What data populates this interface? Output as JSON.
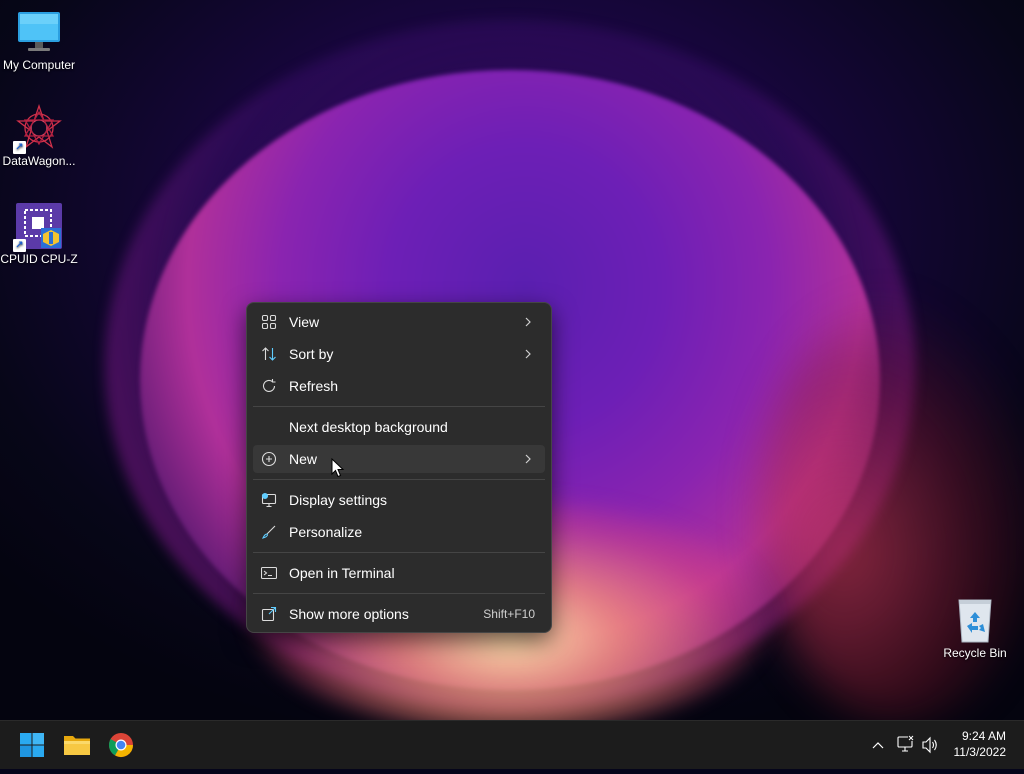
{
  "desktop": {
    "icons": [
      {
        "label": "My Computer"
      },
      {
        "label": "DataWagon..."
      },
      {
        "label": "CPUID CPU-Z"
      },
      {
        "label": "Recycle Bin"
      }
    ]
  },
  "context_menu": {
    "items": [
      {
        "label": "View",
        "icon": "grid-icon",
        "submenu": true
      },
      {
        "label": "Sort by",
        "icon": "sort-icon",
        "submenu": true
      },
      {
        "label": "Refresh",
        "icon": "refresh-icon"
      },
      {
        "label": "Next desktop background",
        "icon": ""
      },
      {
        "label": "New",
        "icon": "plus-circle-icon",
        "submenu": true,
        "highlighted": true
      },
      {
        "label": "Display settings",
        "icon": "display-icon"
      },
      {
        "label": "Personalize",
        "icon": "brush-icon"
      },
      {
        "label": "Open in Terminal",
        "icon": "terminal-icon"
      },
      {
        "label": "Show more options",
        "icon": "share-icon",
        "shortcut": "Shift+F10"
      }
    ]
  },
  "taskbar": {
    "apps": [
      {
        "name": "Start",
        "icon": "windows-logo-icon"
      },
      {
        "name": "File Explorer",
        "icon": "folder-icon"
      },
      {
        "name": "Google Chrome",
        "icon": "chrome-icon"
      }
    ],
    "tray": {
      "time": "9:24 AM",
      "date": "11/3/2022",
      "icons": [
        "chevron-up-icon",
        "network-icon",
        "volume-icon"
      ]
    }
  },
  "colors": {
    "menu_bg": "#2c2c2c",
    "menu_hover": "#383838",
    "taskbar_bg": "#1c1c1c",
    "accent": "#60cdff"
  }
}
